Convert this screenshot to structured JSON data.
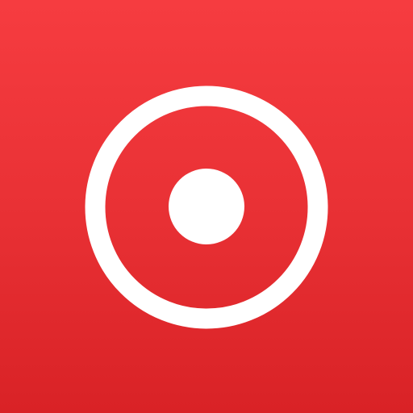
{
  "icon": {
    "name": "record-icon",
    "background_top": "#f63c40",
    "background_mid": "#e93135",
    "background_bottom": "#d92226",
    "glyph_color": "#ffffff"
  }
}
